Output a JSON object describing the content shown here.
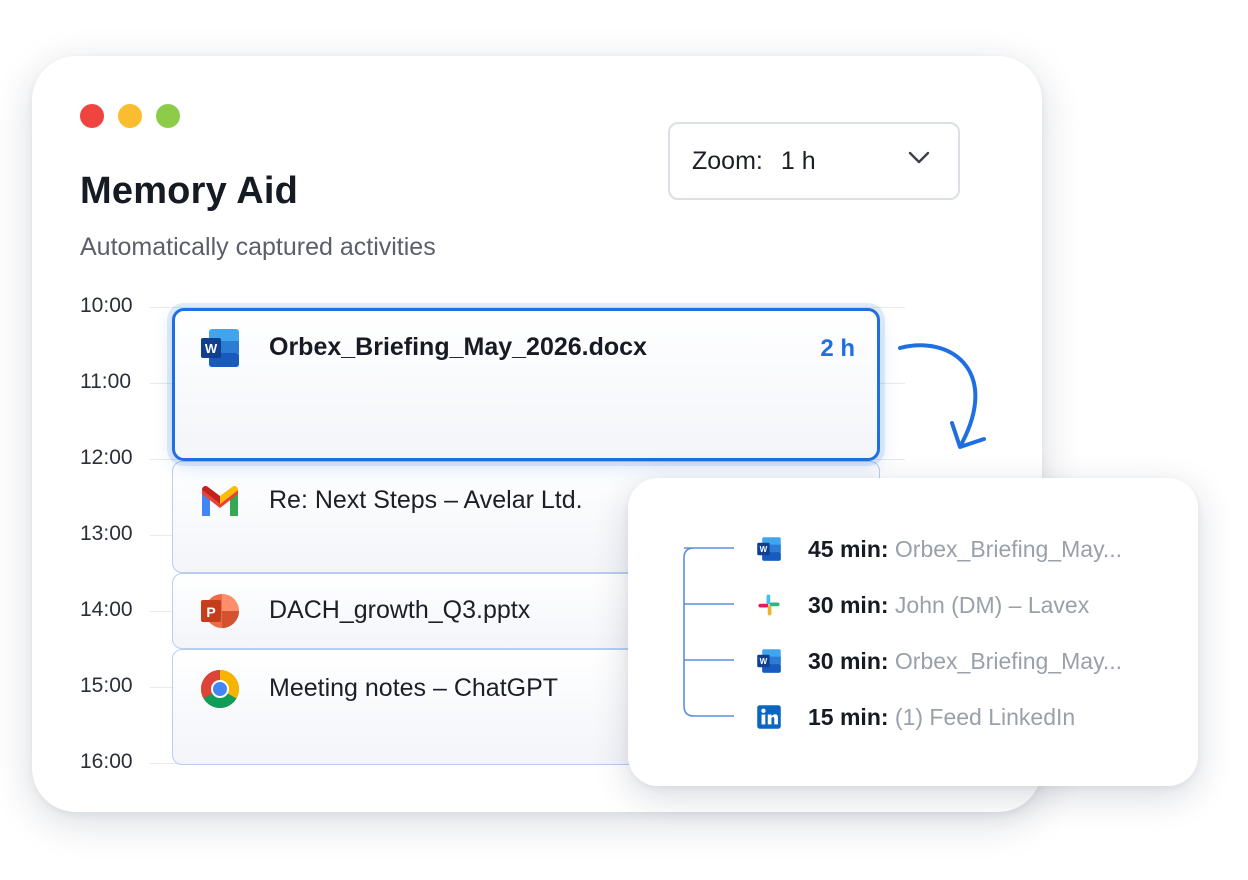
{
  "window": {
    "title": "Memory Aid",
    "subtitle": "Automatically captured activities",
    "controls": [
      "close",
      "minimize",
      "maximize"
    ]
  },
  "zoom": {
    "label": "Zoom:",
    "value": "1 h"
  },
  "timeline": {
    "hours": [
      "10:00",
      "11:00",
      "12:00",
      "13:00",
      "14:00",
      "15:00",
      "16:00"
    ],
    "activities": [
      {
        "icon": "word-icon",
        "title": "Orbex_Briefing_May_2026.docx",
        "duration": "2 h",
        "selected": true
      },
      {
        "icon": "gmail-icon",
        "title": "Re: Next Steps – Avelar Ltd."
      },
      {
        "icon": "powerpoint-icon",
        "title": "DACH_growth_Q3.pptx"
      },
      {
        "icon": "chrome-icon",
        "title": "Meeting notes – ChatGPT"
      }
    ]
  },
  "breakdown": {
    "items": [
      {
        "icon": "word-icon",
        "duration": "45 min:",
        "name": "Orbex_Briefing_May..."
      },
      {
        "icon": "slack-icon",
        "duration": "30 min:",
        "name": "John (DM) – Lavex"
      },
      {
        "icon": "word-icon",
        "duration": "30 min:",
        "name": "Orbex_Briefing_May..."
      },
      {
        "icon": "linkedin-icon",
        "duration": "15 min:",
        "name": "(1) Feed LinkedIn"
      }
    ]
  },
  "colors": {
    "accent": "#1f6fe0",
    "card_border": "#b8cef0",
    "muted_text": "#9aa0aa"
  }
}
